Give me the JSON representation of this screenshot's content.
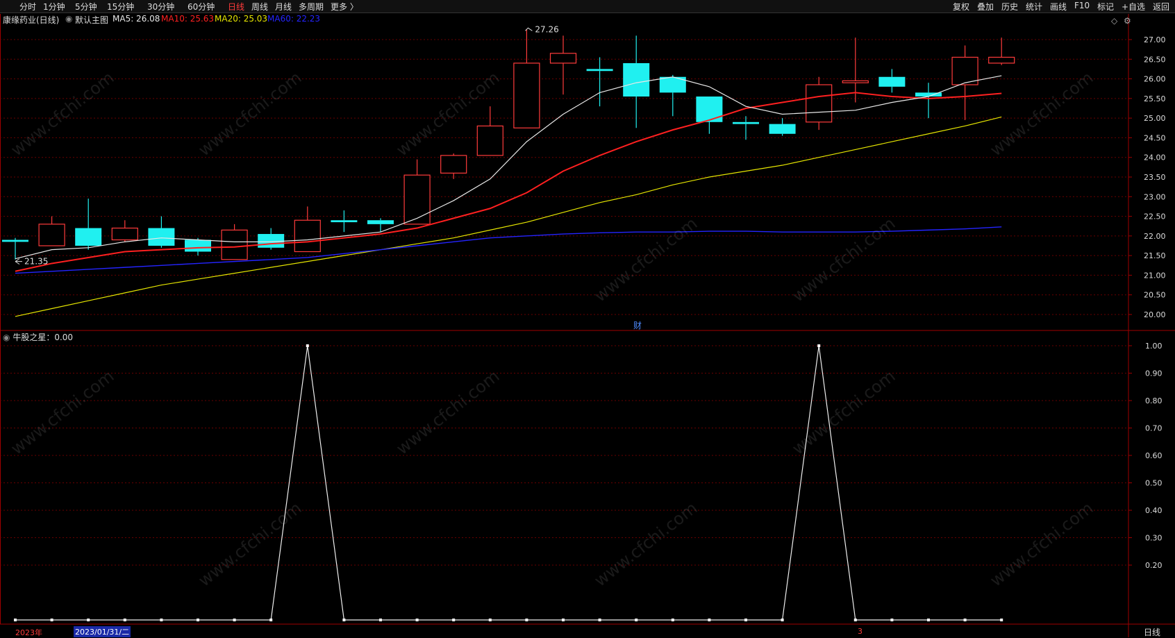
{
  "toolbar": {
    "periods": [
      {
        "label": "分时",
        "active": false
      },
      {
        "label": "1分钟",
        "active": false
      },
      {
        "label": "5分钟",
        "active": false
      },
      {
        "label": "15分钟",
        "active": false
      },
      {
        "label": "30分钟",
        "active": false
      },
      {
        "label": "60分钟",
        "active": false
      },
      {
        "label": "日线",
        "active": true
      },
      {
        "label": "周线",
        "active": false
      },
      {
        "label": "月线",
        "active": false
      },
      {
        "label": "多周期",
        "active": false
      },
      {
        "label": "更多 〉",
        "active": false
      }
    ],
    "right_buttons": [
      "复权",
      "叠加",
      "历史",
      "统计",
      "画线",
      "F10",
      "标记",
      "+自选",
      "返回"
    ]
  },
  "info": {
    "stock": "康缘药业(日线)",
    "template": "默认主图",
    "ma5": "MA5: 26.08",
    "ma10": "MA10: 25.63",
    "ma20": "MA20: 25.03",
    "ma60": "MA60: 22.23"
  },
  "colors": {
    "up": "#ff3b3b",
    "down": "#20f0f0",
    "ma5": "#e8e8e8",
    "ma10": "#ff2020",
    "ma20": "#e6e600",
    "ma60": "#2424ff",
    "grid": "#6a0000"
  },
  "price_axis": [
    "27.00",
    "26.50",
    "26.00",
    "25.50",
    "25.00",
    "24.50",
    "24.00",
    "23.50",
    "23.00",
    "22.50",
    "22.00",
    "21.50",
    "21.00",
    "20.50",
    "20.00"
  ],
  "ind_axis": [
    "1.00",
    "0.90",
    "0.80",
    "0.70",
    "0.60",
    "0.50",
    "0.40",
    "0.30",
    "0.20"
  ],
  "annotations": {
    "high": "27.26",
    "low": "21.35",
    "fin": "财"
  },
  "indicator": {
    "title": "牛股之星：0.00"
  },
  "bottom": {
    "year": "2023年",
    "date": "2023/01/31/二",
    "mark": "3",
    "period": "日线"
  },
  "watermark": "www.cfchi.com",
  "chart_data": {
    "type": "candlestick",
    "price_range": [
      20.0,
      27.0
    ],
    "candles": [
      {
        "o": 21.9,
        "c": 21.85,
        "h": 21.95,
        "l": 21.4
      },
      {
        "o": 21.75,
        "c": 22.3,
        "h": 22.5,
        "l": 21.75
      },
      {
        "o": 22.2,
        "c": 21.75,
        "h": 22.95,
        "l": 21.65
      },
      {
        "o": 21.9,
        "c": 22.2,
        "h": 22.4,
        "l": 21.85
      },
      {
        "o": 22.2,
        "c": 21.75,
        "h": 22.5,
        "l": 21.7
      },
      {
        "o": 21.9,
        "c": 21.6,
        "h": 21.95,
        "l": 21.5
      },
      {
        "o": 21.4,
        "c": 22.15,
        "h": 22.3,
        "l": 21.4
      },
      {
        "o": 22.05,
        "c": 21.7,
        "h": 22.2,
        "l": 21.65
      },
      {
        "o": 21.6,
        "c": 22.4,
        "h": 22.75,
        "l": 21.6
      },
      {
        "o": 22.4,
        "c": 22.35,
        "h": 22.65,
        "l": 22.1
      },
      {
        "o": 22.4,
        "c": 22.3,
        "h": 22.45,
        "l": 22.1
      },
      {
        "o": 22.3,
        "c": 23.55,
        "h": 23.95,
        "l": 22.3
      },
      {
        "o": 23.6,
        "c": 24.05,
        "h": 24.1,
        "l": 23.45
      },
      {
        "o": 24.05,
        "c": 24.8,
        "h": 25.3,
        "l": 24.05
      },
      {
        "o": 24.75,
        "c": 26.4,
        "h": 27.26,
        "l": 24.75
      },
      {
        "o": 26.4,
        "c": 26.65,
        "h": 27.1,
        "l": 25.6
      },
      {
        "o": 26.25,
        "c": 26.2,
        "h": 26.55,
        "l": 25.3
      },
      {
        "o": 26.4,
        "c": 25.55,
        "h": 27.1,
        "l": 24.75
      },
      {
        "o": 26.05,
        "c": 25.65,
        "h": 26.1,
        "l": 25.05
      },
      {
        "o": 25.55,
        "c": 24.9,
        "h": 25.55,
        "l": 24.6
      },
      {
        "o": 24.9,
        "c": 24.85,
        "h": 25.05,
        "l": 24.45
      },
      {
        "o": 24.85,
        "c": 24.6,
        "h": 25.0,
        "l": 24.55
      },
      {
        "o": 24.9,
        "c": 25.85,
        "h": 26.05,
        "l": 24.7
      },
      {
        "o": 25.9,
        "c": 25.95,
        "h": 27.05,
        "l": 25.4
      },
      {
        "o": 26.05,
        "c": 25.8,
        "h": 26.25,
        "l": 25.65
      },
      {
        "o": 25.65,
        "c": 25.55,
        "h": 25.9,
        "l": 25.0
      },
      {
        "o": 25.85,
        "c": 26.55,
        "h": 26.85,
        "l": 24.95
      },
      {
        "o": 26.4,
        "c": 26.55,
        "h": 27.05,
        "l": 26.35
      }
    ],
    "ma5": [
      21.42,
      21.65,
      21.7,
      21.85,
      21.95,
      21.9,
      21.85,
      21.85,
      21.9,
      22.0,
      22.1,
      22.45,
      22.9,
      23.45,
      24.4,
      25.1,
      25.65,
      25.9,
      26.05,
      25.8,
      25.3,
      25.1,
      25.15,
      25.2,
      25.4,
      25.55,
      25.9,
      26.08
    ],
    "ma10": [
      21.1,
      21.3,
      21.45,
      21.6,
      21.65,
      21.7,
      21.72,
      21.8,
      21.85,
      21.95,
      22.05,
      22.2,
      22.45,
      22.7,
      23.1,
      23.65,
      24.05,
      24.4,
      24.7,
      24.95,
      25.25,
      25.4,
      25.55,
      25.65,
      25.55,
      25.5,
      25.55,
      25.63
    ],
    "ma20": [
      19.95,
      20.15,
      20.35,
      20.55,
      20.75,
      20.9,
      21.05,
      21.2,
      21.35,
      21.5,
      21.65,
      21.8,
      21.95,
      22.15,
      22.35,
      22.6,
      22.85,
      23.05,
      23.3,
      23.5,
      23.65,
      23.8,
      24.0,
      24.2,
      24.4,
      24.6,
      24.8,
      25.03
    ],
    "ma60": [
      21.05,
      21.1,
      21.15,
      21.2,
      21.25,
      21.3,
      21.35,
      21.4,
      21.45,
      21.55,
      21.65,
      21.75,
      21.85,
      21.95,
      22.0,
      22.05,
      22.08,
      22.1,
      22.1,
      22.12,
      22.12,
      22.1,
      22.1,
      22.1,
      22.12,
      22.15,
      22.18,
      22.23
    ],
    "indicator_values": [
      0,
      0,
      0,
      0,
      0,
      0,
      0,
      0,
      1,
      0,
      0,
      0,
      0,
      0,
      0,
      0,
      0,
      0,
      0,
      0,
      0,
      0,
      1,
      0,
      0,
      0,
      0,
      0
    ],
    "indicator_range": [
      0.0,
      1.0
    ]
  }
}
